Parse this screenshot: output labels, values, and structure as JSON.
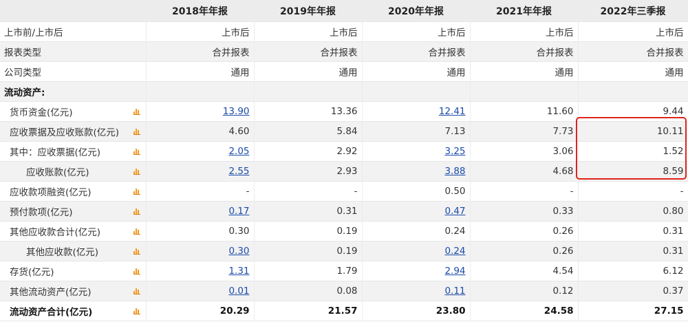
{
  "columns": [
    "",
    "2018年年报",
    "2019年年报",
    "2020年年报",
    "2021年年报",
    "2022年三季报"
  ],
  "rows": [
    {
      "label": "上市前/上市后",
      "values": [
        "上市后",
        "上市后",
        "上市后",
        "上市后",
        "上市后"
      ],
      "links": [
        false,
        false,
        false,
        false,
        false
      ],
      "icon": false,
      "bold": false,
      "indent": 0,
      "alt": false
    },
    {
      "label": "报表类型",
      "values": [
        "合并报表",
        "合并报表",
        "合并报表",
        "合并报表",
        "合并报表"
      ],
      "links": [
        false,
        false,
        false,
        false,
        false
      ],
      "icon": false,
      "bold": false,
      "indent": 0,
      "alt": true
    },
    {
      "label": "公司类型",
      "values": [
        "通用",
        "通用",
        "通用",
        "通用",
        "通用"
      ],
      "links": [
        false,
        false,
        false,
        false,
        false
      ],
      "icon": false,
      "bold": false,
      "indent": 0,
      "alt": false
    },
    {
      "label": "流动资产:",
      "values": [
        "",
        "",
        "",
        "",
        ""
      ],
      "links": [
        false,
        false,
        false,
        false,
        false
      ],
      "icon": false,
      "bold": true,
      "indent": 0,
      "alt": true
    },
    {
      "label": "货币资金(亿元)",
      "values": [
        "13.90",
        "13.36",
        "12.41",
        "11.60",
        "9.44"
      ],
      "links": [
        true,
        false,
        true,
        false,
        false
      ],
      "icon": true,
      "bold": false,
      "indent": 1,
      "alt": false
    },
    {
      "label": "应收票据及应收账款(亿元)",
      "values": [
        "4.60",
        "5.84",
        "7.13",
        "7.73",
        "10.11"
      ],
      "links": [
        false,
        false,
        false,
        false,
        false
      ],
      "icon": true,
      "bold": false,
      "indent": 1,
      "alt": true
    },
    {
      "label": "其中：应收票据(亿元)",
      "values": [
        "2.05",
        "2.92",
        "3.25",
        "3.06",
        "1.52"
      ],
      "links": [
        true,
        false,
        true,
        false,
        false
      ],
      "icon": true,
      "bold": false,
      "indent": 1,
      "alt": false
    },
    {
      "label": "应收账款(亿元)",
      "values": [
        "2.55",
        "2.93",
        "3.88",
        "4.68",
        "8.59"
      ],
      "links": [
        true,
        false,
        true,
        false,
        false
      ],
      "icon": true,
      "bold": false,
      "indent": 2,
      "alt": true
    },
    {
      "label": "应收款项融资(亿元)",
      "values": [
        "-",
        "-",
        "0.50",
        "-",
        "-"
      ],
      "links": [
        false,
        false,
        false,
        false,
        false
      ],
      "icon": true,
      "bold": false,
      "indent": 1,
      "alt": false
    },
    {
      "label": "预付款项(亿元)",
      "values": [
        "0.17",
        "0.31",
        "0.47",
        "0.33",
        "0.80"
      ],
      "links": [
        true,
        false,
        true,
        false,
        false
      ],
      "icon": true,
      "bold": false,
      "indent": 1,
      "alt": true
    },
    {
      "label": "其他应收款合计(亿元)",
      "values": [
        "0.30",
        "0.19",
        "0.24",
        "0.26",
        "0.31"
      ],
      "links": [
        false,
        false,
        false,
        false,
        false
      ],
      "icon": true,
      "bold": false,
      "indent": 1,
      "alt": false
    },
    {
      "label": "其他应收款(亿元)",
      "values": [
        "0.30",
        "0.19",
        "0.24",
        "0.26",
        "0.31"
      ],
      "links": [
        true,
        false,
        true,
        false,
        false
      ],
      "icon": true,
      "bold": false,
      "indent": 2,
      "alt": true
    },
    {
      "label": "存货(亿元)",
      "values": [
        "1.31",
        "1.79",
        "2.94",
        "4.54",
        "6.12"
      ],
      "links": [
        true,
        false,
        true,
        false,
        false
      ],
      "icon": true,
      "bold": false,
      "indent": 1,
      "alt": false
    },
    {
      "label": "其他流动资产(亿元)",
      "values": [
        "0.01",
        "0.08",
        "0.11",
        "0.12",
        "0.37"
      ],
      "links": [
        true,
        false,
        true,
        false,
        false
      ],
      "icon": true,
      "bold": false,
      "indent": 1,
      "alt": true
    },
    {
      "label": "流动资产合计(亿元)",
      "values": [
        "20.29",
        "21.57",
        "23.80",
        "24.58",
        "27.15"
      ],
      "links": [
        false,
        false,
        false,
        false,
        false
      ],
      "icon": true,
      "bold": true,
      "indent": 1,
      "alt": false
    }
  ],
  "icons": {
    "row_chart": "bar-chart-icon"
  },
  "colors": {
    "highlight": "#e0231a",
    "link": "#1a4aa8",
    "chart_icon": "#f29a1e",
    "header_bg": "#ececec",
    "alt_row_bg": "#f2f2f2"
  }
}
